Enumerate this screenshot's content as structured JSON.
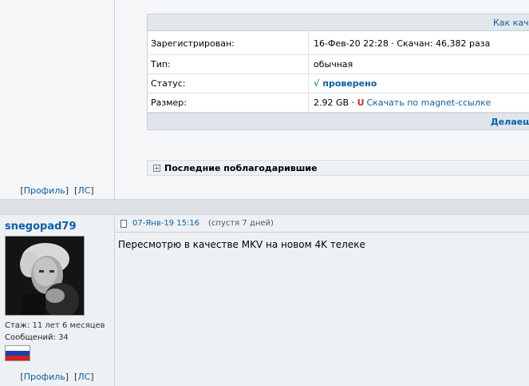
{
  "top_post": {
    "profile_link": "Профиль",
    "pm_link": "ЛС",
    "info": {
      "head_link": "Как кач",
      "rows": [
        {
          "key": "Зарегистрирован:",
          "value": "16-Фев-20 22:28 · Скачан: 46,382 раза"
        },
        {
          "key": "Тип:",
          "value": "обычная"
        },
        {
          "key": "Статус:",
          "value": "проверено",
          "status_mark": "√"
        },
        {
          "key": "Размер:",
          "value": "2.92 GB ·",
          "magnet": "Скачать по magnet-ссылке"
        }
      ],
      "foot_link": "Делаеш"
    },
    "thanks_label": "Последние поблагодарившие"
  },
  "post2": {
    "nick": "snegopad79",
    "stats": [
      {
        "label": "Стаж:",
        "value": "11 лет 6 месяцев"
      },
      {
        "label": "Сообщений:",
        "value": "34"
      }
    ],
    "date": "07-Янв-19 15:16",
    "after": "(спустя 7 дней)",
    "body": "Пересмотрю в качестве MKV на новом 4K телеке",
    "profile_link": "Профиль",
    "pm_link": "ЛС"
  },
  "colors": {
    "link": "#0b5fa6",
    "ok_check": "#2a9a2a",
    "magnet": "#c0392b"
  },
  "flag": "russia-flag",
  "avatar": "user-avatar-photo"
}
